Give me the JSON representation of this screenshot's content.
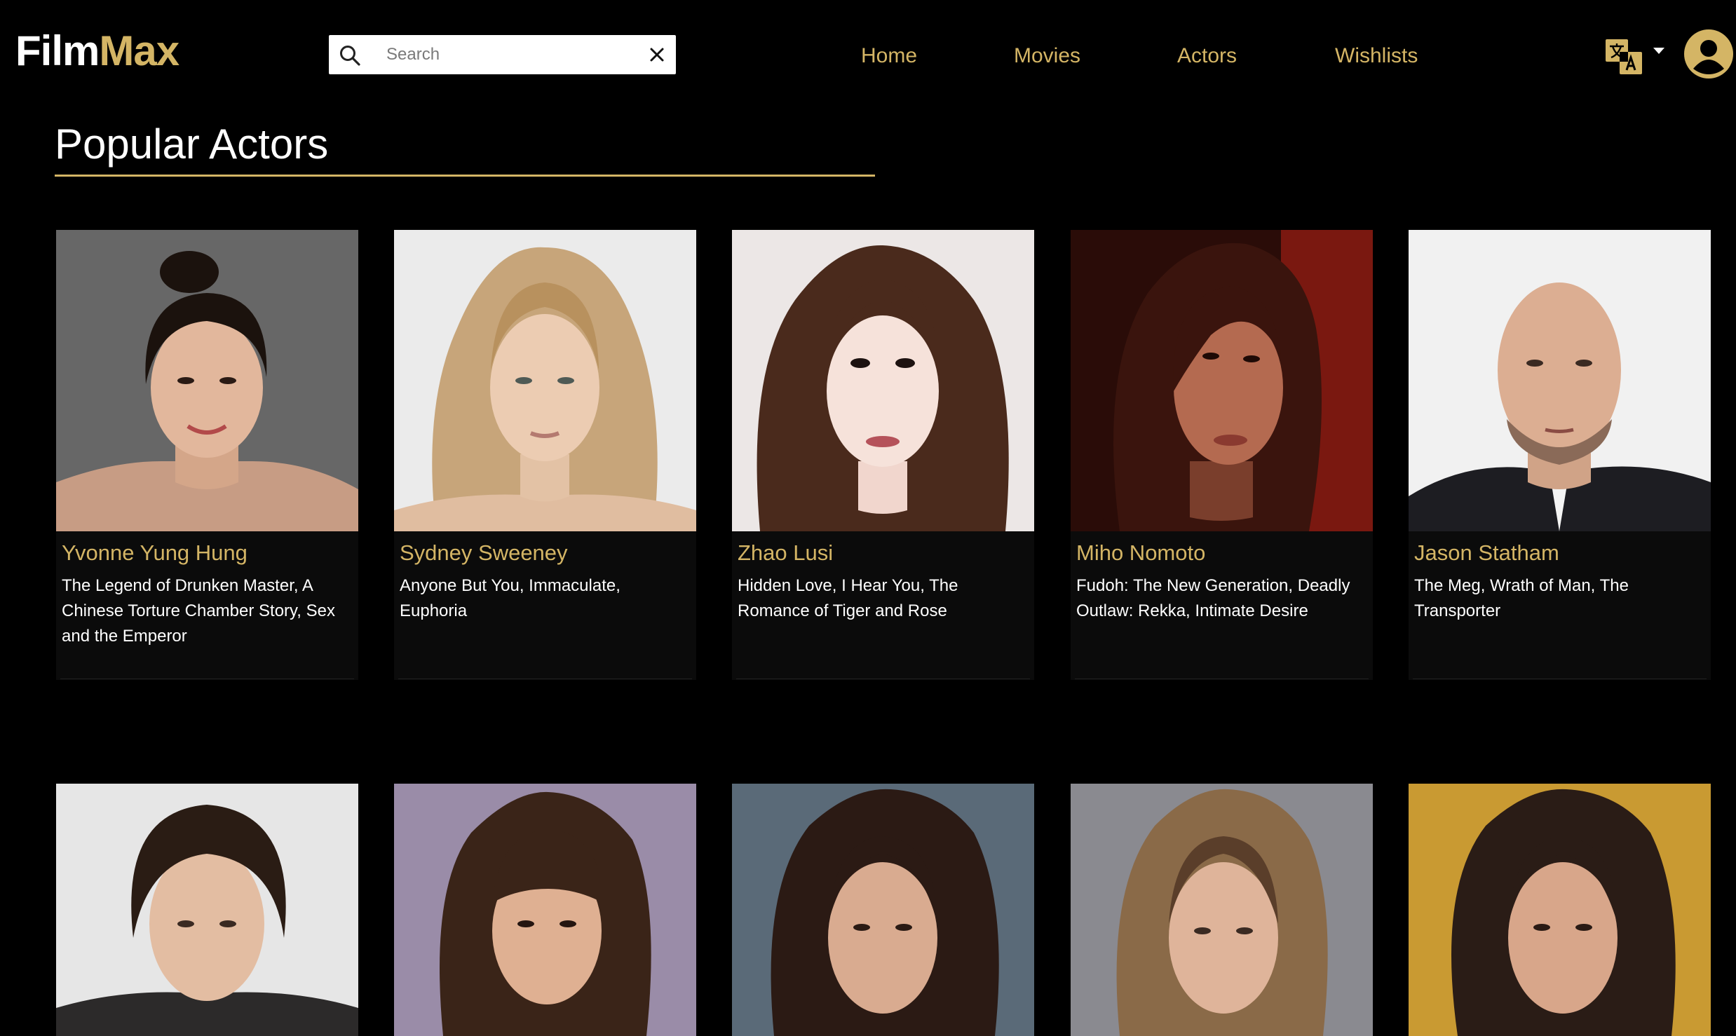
{
  "brand": {
    "part1": "Film",
    "part2": "Max"
  },
  "search": {
    "placeholder": "Search"
  },
  "nav": [
    "Home",
    "Movies",
    "Actors",
    "Wishlists"
  ],
  "icons": {
    "search": "search-icon",
    "clear": "close-icon",
    "language": "translate-icon",
    "dropdown": "caret-down-icon",
    "user": "user-avatar-icon"
  },
  "colors": {
    "accent": "#d4b565",
    "background": "#000000",
    "card": "#0b0b0b"
  },
  "section": {
    "title": "Popular Actors"
  },
  "actors": [
    {
      "name": "Yvonne Yung Hung",
      "films": "The Legend of Drunken Master, A Chinese Torture Chamber Story, Sex and the Emperor"
    },
    {
      "name": "Sydney Sweeney",
      "films": "Anyone But You, Immaculate, Euphoria"
    },
    {
      "name": "Zhao Lusi",
      "films": "Hidden Love, I Hear You, The Romance of Tiger and Rose"
    },
    {
      "name": "Miho Nomoto",
      "films": "Fudoh: The New Generation, Deadly Outlaw: Rekka, Intimate Desire"
    },
    {
      "name": "Jason Statham",
      "films": "The Meg, Wrath of Man, The Transporter"
    }
  ]
}
